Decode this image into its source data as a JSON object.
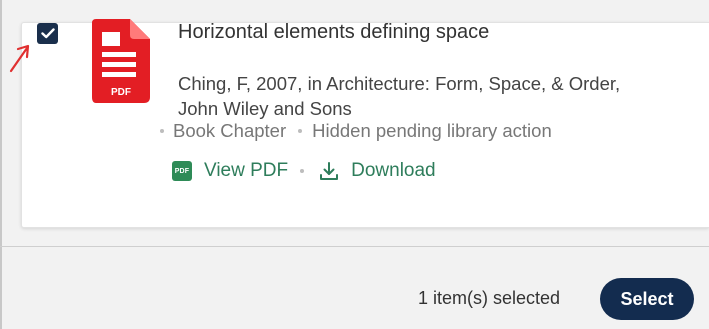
{
  "result": {
    "title": "Horizontal elements defining space",
    "citation": "Ching, F, 2007, in Architecture: Form, Space, & Order, John Wiley and Sons",
    "type": "Book Chapter",
    "status": "Hidden pending library action",
    "checked": true,
    "file_icon": "pdf-file-icon",
    "file_icon_label": "PDF"
  },
  "actions": {
    "view_pdf_label": "View PDF",
    "view_pdf_badge": "PDF",
    "download_label": "Download"
  },
  "footer": {
    "selected_count": "1 item(s) selected",
    "select_label": "Select"
  },
  "colors": {
    "checkbox": "#1a2f4c",
    "pdf_red": "#e31e24",
    "action_green": "#2e7d5b",
    "select_button": "#132c4f",
    "annotation_arrow": "#e03030"
  }
}
